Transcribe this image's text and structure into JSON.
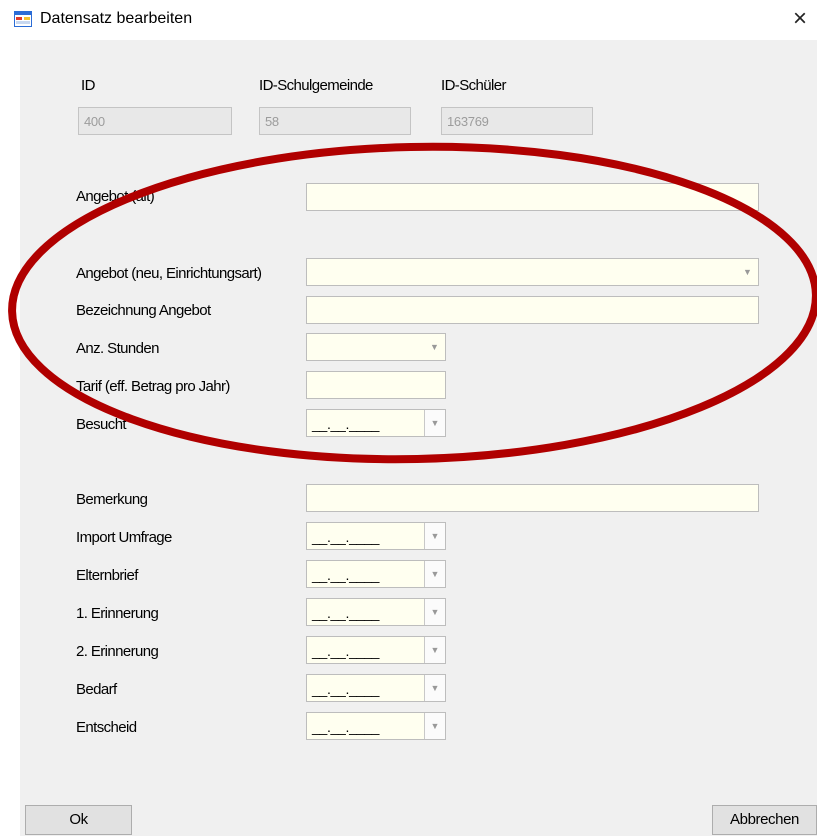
{
  "window": {
    "title": "Datensatz bearbeiten",
    "close_glyph": "×",
    "icon": "form-window-icon"
  },
  "ids": {
    "id_label": "ID",
    "id_value": "400",
    "schulgemeinde_label": "ID-Schulgemeinde",
    "schulgemeinde_value": "58",
    "schueler_label": "ID-Schüler",
    "schueler_value": "163769"
  },
  "fields": {
    "angebot_alt_label": "Angebot (alt)",
    "angebot_neu_label": "Angebot (neu, Einrichtungsart)",
    "bezeichnung_label": "Bezeichnung Angebot",
    "stunden_label": "Anz. Stunden",
    "tarif_label": "Tarif (eff. Betrag pro Jahr)",
    "besucht_label": "Besucht",
    "bemerkung_label": "Bemerkung",
    "import_label": "Import Umfrage",
    "elternbrief_label": "Elternbrief",
    "erinnerung1_label": "1. Erinnerung",
    "erinnerung2_label": "2. Erinnerung",
    "bedarf_label": "Bedarf",
    "entscheid_label": "Entscheid"
  },
  "date_mask": "__.__.____",
  "dropdown_arrow": "▼",
  "buttons": {
    "ok": "Ok",
    "cancel": "Abbrechen"
  },
  "colors": {
    "input_background": "#fffff0",
    "readonly_background": "#e8e8e8",
    "dialog_background": "#f0f0f0",
    "annotation_ellipse": "#b00000"
  }
}
